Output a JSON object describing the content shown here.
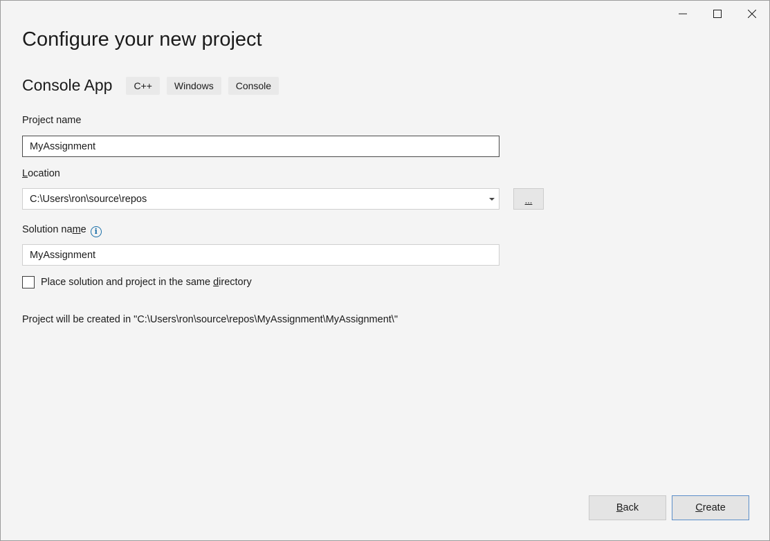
{
  "window": {
    "controls": {
      "minimize_icon": "minimize-icon",
      "maximize_icon": "maximize-icon",
      "close_icon": "close-icon"
    }
  },
  "page": {
    "title": "Configure your new project"
  },
  "template": {
    "name": "Console App",
    "tags": [
      "C++",
      "Windows",
      "Console"
    ]
  },
  "form": {
    "project_name": {
      "label": "Project name",
      "value": "MyAssignment"
    },
    "location": {
      "label_prefix": "",
      "label_accel": "L",
      "label_rest": "ocation",
      "value": "C:\\Users\\ron\\source\\repos"
    },
    "browse_button_label": "...",
    "solution_name": {
      "label_prefix": "Solution na",
      "label_accel": "m",
      "label_rest": "e",
      "value": "MyAssignment"
    },
    "same_directory": {
      "label_prefix": "Place solution and project in the same ",
      "label_accel": "d",
      "label_rest": "irectory",
      "checked": false
    }
  },
  "created_path_text": "Project will be created in \"C:\\Users\\ron\\source\\repos\\MyAssignment\\MyAssignment\\\"",
  "footer": {
    "back_accel": "B",
    "back_rest": "ack",
    "create_accel": "C",
    "create_rest": "reate"
  },
  "colors": {
    "background": "#f4f4f4",
    "accent_border": "#5b8ec9",
    "info_icon": "#1a6fa8"
  }
}
